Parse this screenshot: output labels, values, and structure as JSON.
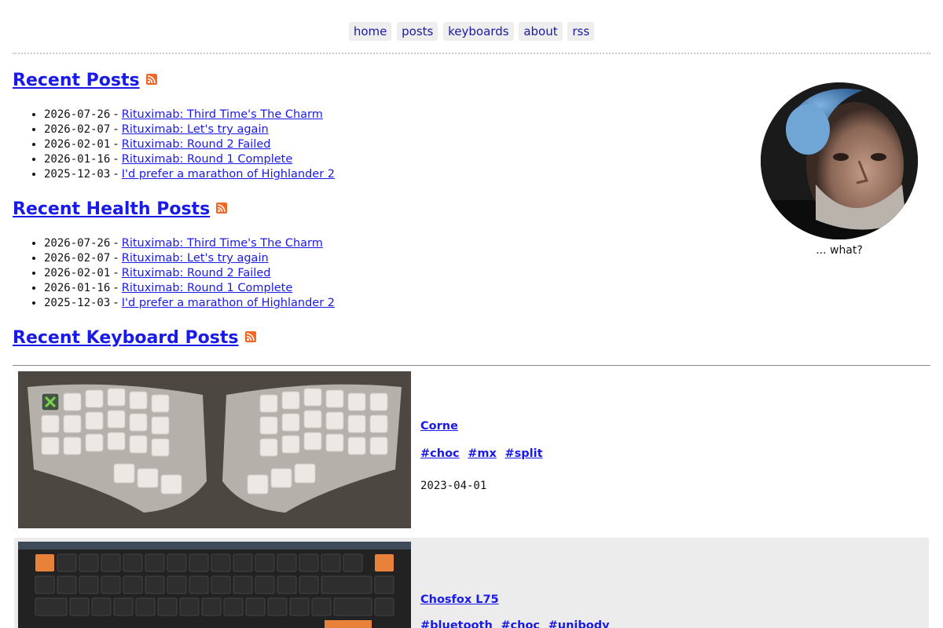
{
  "nav": {
    "items": [
      {
        "label": "home"
      },
      {
        "label": "posts"
      },
      {
        "label": "keyboards"
      },
      {
        "label": "about"
      },
      {
        "label": "rss"
      }
    ]
  },
  "recent_posts": {
    "title": "Recent Posts",
    "items": [
      {
        "date": "2026-07-26",
        "title": "Rituximab: Third Time's The Charm"
      },
      {
        "date": "2026-02-07",
        "title": "Rituximab: Let's try again"
      },
      {
        "date": "2026-02-01",
        "title": "Rituximab: Round 2 Failed"
      },
      {
        "date": "2026-01-16",
        "title": "Rituximab: Round 1 Complete"
      },
      {
        "date": "2025-12-03",
        "title": "I'd prefer a marathon of Highlander 2"
      }
    ]
  },
  "recent_health_posts": {
    "title": "Recent Health Posts",
    "items": [
      {
        "date": "2026-07-26",
        "title": "Rituximab: Third Time's The Charm"
      },
      {
        "date": "2026-02-07",
        "title": "Rituximab: Let's try again"
      },
      {
        "date": "2026-02-01",
        "title": "Rituximab: Round 2 Failed"
      },
      {
        "date": "2026-01-16",
        "title": "Rituximab: Round 1 Complete"
      },
      {
        "date": "2025-12-03",
        "title": "I'd prefer a marathon of Highlander 2"
      }
    ]
  },
  "recent_keyboard_posts": {
    "title": "Recent Keyboard Posts",
    "items": [
      {
        "name": "Corne",
        "tags": [
          "#choc",
          "#mx",
          "#split"
        ],
        "date": "2023-04-01"
      },
      {
        "name": "Chosfox L75",
        "tags": [
          "#bluetooth",
          "#choc",
          "#unibody"
        ],
        "date": ""
      }
    ]
  },
  "avatar": {
    "caption": "... what?"
  },
  "separator": " - ",
  "colors": {
    "link": "#1a1ae6",
    "nav_bg": "#eeeeee",
    "rss": "#f26522",
    "alt_row": "#ececec"
  },
  "icons": {
    "rss": "rss-icon"
  }
}
